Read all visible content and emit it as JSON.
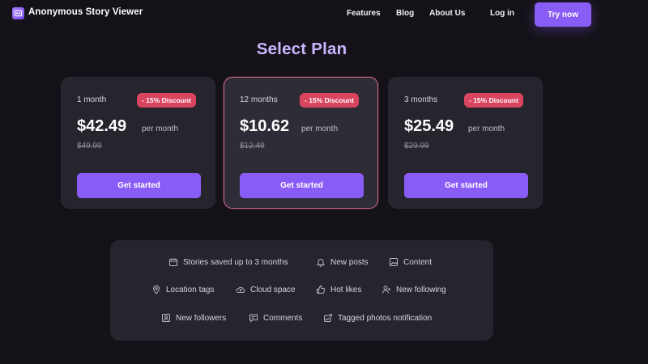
{
  "header": {
    "brand": "Anonymous Story Viewer",
    "logo_icon": "story-logo-icon",
    "nav": [
      "Features",
      "Blog",
      "About Us",
      "Log in"
    ],
    "try_label": "Try now"
  },
  "main": {
    "title": "Select Plan"
  },
  "plans": [
    {
      "period": "1 month",
      "badge": "- 15% Discount",
      "price": "$42.49",
      "per": "per month",
      "old_price": "$49.99",
      "cta": "Get started"
    },
    {
      "period": "12 months",
      "badge": "- 15% Discount",
      "price": "$10.62",
      "per": "per month",
      "old_price": "$12.49",
      "cta": "Get started"
    },
    {
      "period": "3 months",
      "badge": "- 15% Discount",
      "price": "$25.49",
      "per": "per month",
      "old_price": "$29.99",
      "cta": "Get started"
    }
  ],
  "features": [
    {
      "label": "Stories saved up to 3 months",
      "icon": "calendar-icon"
    },
    {
      "label": "New posts",
      "icon": "bell-icon"
    },
    {
      "label": "Content",
      "icon": "image-icon"
    },
    {
      "label": "Location tags",
      "icon": "location-pin-icon"
    },
    {
      "label": "Cloud space",
      "icon": "cloud-upload-icon"
    },
    {
      "label": "Hot likes",
      "icon": "thumbs-up-icon"
    },
    {
      "label": "New following",
      "icon": "user-plus-icon"
    },
    {
      "label": "New followers",
      "icon": "user-badge-icon"
    },
    {
      "label": "Comments",
      "icon": "comment-icon"
    },
    {
      "label": "Tagged photos notification",
      "icon": "tagged-photo-icon"
    }
  ],
  "colors": {
    "background": "#141218",
    "accent": "#8a5cf6",
    "title": "#c9b5ff",
    "badge": "#d9455f",
    "card": "#26242c"
  }
}
